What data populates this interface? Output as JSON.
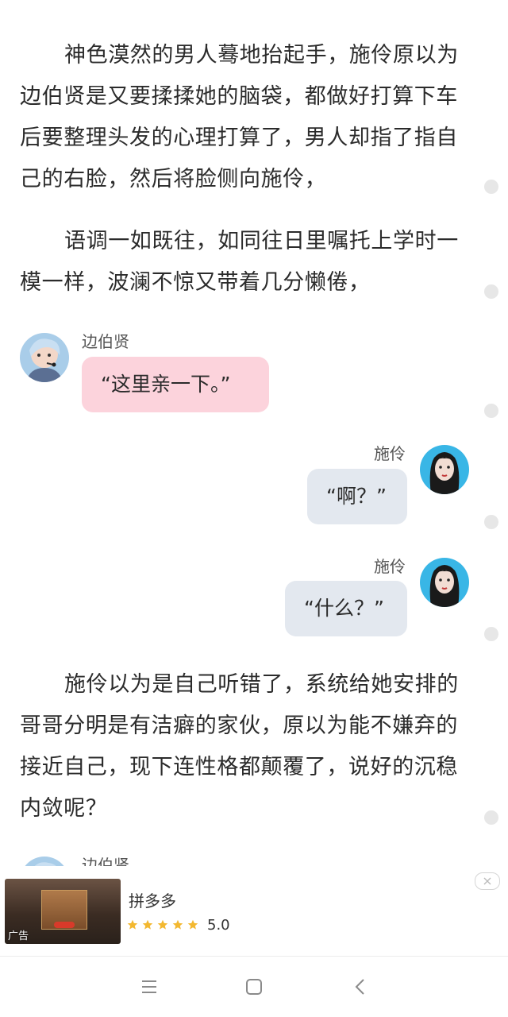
{
  "paragraphs": [
    {
      "text": "神色漠然的男人蓦地抬起手，施伶原以为边伯贤是又要揉揉她的脑袋，都做好打算下车后要整理头发的心理打算了，男人却指了指自己的右脸，然后将脸侧向施伶，"
    },
    {
      "text": "语调一如既往，如同往日里嘱托上学时一模一样，波澜不惊又带着几分懒倦，"
    },
    {
      "text": "施伶以为是自己听错了，系统给她安排的哥哥分明是有洁癖的家伙，原以为能不嫌弃的接近自己，现下连性格都颠覆了，说好的沉稳内敛呢？"
    }
  ],
  "messages": [
    {
      "speaker": "边伯贤",
      "text": "“这里亲一下。”",
      "side": "left"
    },
    {
      "speaker": "施伶",
      "text": "“啊？”",
      "side": "right"
    },
    {
      "speaker": "施伶",
      "text": "“什么？”",
      "side": "right"
    },
    {
      "speaker": "边伯贤",
      "side": "left"
    }
  ],
  "ad": {
    "title": "拼多多",
    "rating": "5.0",
    "stars": 5,
    "tag": "广告",
    "star_color": "#f3b830"
  },
  "colors": {
    "pink_bubble": "#fcd3dc",
    "grey_bubble": "#e3e8ef",
    "text": "#2b2b2b"
  },
  "navbar": {
    "buttons": [
      "menu-icon",
      "home-square-icon",
      "back-chevron-icon"
    ]
  }
}
